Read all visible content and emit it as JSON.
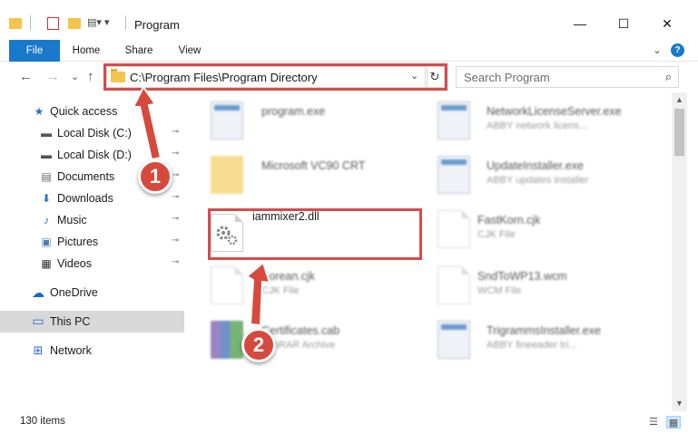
{
  "window": {
    "title": "Program",
    "minimize": "—",
    "maximize": "☐",
    "close": "✕"
  },
  "ribbon": {
    "tabs": [
      "File",
      "Home",
      "Share",
      "View"
    ],
    "expand": "⌄",
    "help": "?"
  },
  "address": {
    "path": "C:\\Program Files\\Program Directory",
    "dropdown": "⌄",
    "refresh": "↻"
  },
  "search": {
    "placeholder": "Search Program",
    "icon": "⌕"
  },
  "nav_buttons": {
    "back": "←",
    "forward": "→",
    "recent": "⌄",
    "up": "↑"
  },
  "sidebar": {
    "items": [
      {
        "label": "Quick access",
        "icon": "★",
        "pinned": false
      },
      {
        "label": "Local Disk (C:)",
        "icon": "▬",
        "pinned": true
      },
      {
        "label": "Local Disk (D:)",
        "icon": "▬",
        "pinned": true
      },
      {
        "label": "Documents",
        "icon": "▤",
        "pinned": true
      },
      {
        "label": "Downloads",
        "icon": "⬇",
        "pinned": true
      },
      {
        "label": "Music",
        "icon": "♪",
        "pinned": true
      },
      {
        "label": "Pictures",
        "icon": "▣",
        "pinned": true
      },
      {
        "label": "Videos",
        "icon": "▦",
        "pinned": true
      },
      {
        "label": "OneDrive",
        "icon": "☁",
        "pinned": false
      },
      {
        "label": "This PC",
        "icon": "▭",
        "pinned": false
      },
      {
        "label": "Network",
        "icon": "⊞",
        "pinned": false
      }
    ],
    "pin_glyph": "📌"
  },
  "files": [
    {
      "name": "program.exe",
      "type": ""
    },
    {
      "name": "NetworkLicenseServer.exe",
      "type": "ABBY network licens..."
    },
    {
      "name": "Microsoft VC90 CRT",
      "type": ""
    },
    {
      "name": "UpdateInstaller.exe",
      "type": "ABBY updates installer"
    },
    {
      "name": "iammixer2.dll",
      "type": ""
    },
    {
      "name": "FastKorn.cjk",
      "type": "CJK File"
    },
    {
      "name": "Korean.cjk",
      "type": "CJK File"
    },
    {
      "name": "SndToWP13.wcm",
      "type": "WCM File"
    },
    {
      "name": "Certificates.cab",
      "type": "WinRAR Archive"
    },
    {
      "name": "TrigrammsInstaller.exe",
      "type": "ABBY fineeader tri..."
    }
  ],
  "status": {
    "item_count": "130 items",
    "details_view": "☰",
    "icons_view": "▦"
  },
  "annotations": {
    "step1": "1",
    "step2": "2"
  },
  "colors": {
    "file_tab": "#1979ca",
    "callout": "#d64a3e",
    "highlight_box": "#d84a4a"
  }
}
